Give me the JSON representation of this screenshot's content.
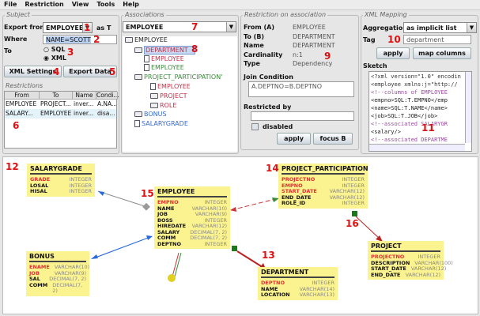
{
  "menu": [
    "File",
    "Restriction",
    "View",
    "Tools",
    "Help"
  ],
  "subject": {
    "title": "Subject",
    "export_from_label": "Export from",
    "export_from_value": "EMPLOYEE",
    "as_label": "as T",
    "where_label": "Where",
    "where_value": "NAME=SCOTT",
    "to_label": "To",
    "sql": "SQL",
    "xml": "XML",
    "selected": "XML",
    "xml_settings": "XML Settings",
    "export_data": "Export Data"
  },
  "restrictions": {
    "title": "Restrictions",
    "columns": [
      "From",
      "To",
      "Name",
      "Condi..."
    ],
    "rows": [
      [
        "EMPLOYEE",
        "PROJECT...",
        "inver...",
        "A.NA..."
      ],
      [
        "SALARY...",
        "EMPLOYEE",
        "inver...",
        "disa..."
      ]
    ]
  },
  "associations": {
    "title": "Associations",
    "combo": "EMPLOYEE",
    "tree": [
      {
        "label": "EMPLOYEE",
        "color": "#222",
        "icon": "folder"
      },
      {
        "label": "DEPARTMENT",
        "color": "#c0304a",
        "icon": "folder",
        "selected": true
      },
      {
        "label": "EMPLOYEE",
        "color": "#c0304a",
        "icon": "doc"
      },
      {
        "label": "EMPLOYEE",
        "color": "#3a8a3a",
        "icon": "doc"
      },
      {
        "label": "PROJECT_PARTICIPATION'",
        "color": "#3a8a3a",
        "icon": "folder"
      },
      {
        "label": "EMPLOYEE",
        "color": "#c0304a",
        "icon": "doc"
      },
      {
        "label": "PROJECT",
        "color": "#c0304a",
        "icon": "folder"
      },
      {
        "label": "ROLE",
        "color": "#c0304a",
        "icon": "folder"
      },
      {
        "label": "BONUS",
        "color": "#3a6ad0",
        "icon": "folder"
      },
      {
        "label": "SALARYGRADE",
        "color": "#3a6ad0",
        "icon": "doc"
      }
    ]
  },
  "restriction": {
    "title": "Restriction on association",
    "fields": [
      [
        "From (A)",
        "EMPLOYEE"
      ],
      [
        "To (B)",
        "DEPARTMENT"
      ],
      [
        "Name",
        "DEPARTMENT"
      ],
      [
        "Cardinality",
        "n:1"
      ],
      [
        "Type",
        "Dependency"
      ]
    ],
    "join_label": "Join Condition",
    "join_value": "A.DEPTNO=B.DEPTNO",
    "restricted_by_label": "Restricted by",
    "restricted_by_value": "",
    "disabled_label": "disabled",
    "apply": "apply",
    "focus": "focus B"
  },
  "xml_mapping": {
    "title": "XML Mapping",
    "aggregation_label": "Aggregation",
    "aggregation_value": "as implicit list",
    "tag_label": "Tag",
    "tag_value": "department",
    "apply": "apply",
    "map_columns": "map columns",
    "sketch_label": "Sketch",
    "sketch": [
      {
        "text": "<?xml version=\"1.0\" encodin",
        "color": "#333"
      },
      {
        "text": "<employee xmlns:j=\"http://",
        "color": "#333"
      },
      {
        "text": "   <!--columns of EMPLOYEE",
        "color": "#9a4aa0"
      },
      {
        "text": "   <empno>SQL:T.EMPNO</emp",
        "color": "#222"
      },
      {
        "text": "   <name>SQL:T.NAME</name>",
        "color": "#222"
      },
      {
        "text": "   <job>SQL:T.JOB</job>",
        "color": "#222"
      },
      {
        "text": "   <!--associated SALARYGR",
        "color": "#9a4aa0"
      },
      {
        "text": "   <salary/>",
        "color": "#222"
      },
      {
        "text": "   <!--associated DEPARTME",
        "color": "#9a4aa0"
      }
    ]
  },
  "callouts": [
    "1",
    "2",
    "3",
    "4",
    "5",
    "6",
    "7",
    "8",
    "9",
    "10",
    "11",
    "12",
    "13",
    "14",
    "15",
    "16"
  ],
  "entities": {
    "salarygrade": {
      "name": "SALARYGRADE",
      "cols": [
        [
          "GRADE",
          "INTEGER",
          true
        ],
        [
          "LOSAL",
          "INTEGER",
          false
        ],
        [
          "HISAL",
          "INTEGER",
          false
        ]
      ]
    },
    "employee": {
      "name": "EMPLOYEE",
      "cols": [
        [
          "EMPNO",
          "INTEGER",
          true
        ],
        [
          "NAME",
          "VARCHAR(10)",
          false
        ],
        [
          "JOB",
          "VARCHAR(9)",
          false
        ],
        [
          "BOSS",
          "INTEGER",
          false
        ],
        [
          "HIREDATE",
          "VARCHAR(12)",
          false
        ],
        [
          "SALARY",
          "DECIMAL(7, 2)",
          false
        ],
        [
          "COMM",
          "DECIMAL(7, 2)",
          false
        ],
        [
          "DEPTNO",
          "INTEGER",
          false
        ]
      ]
    },
    "bonus": {
      "name": "BONUS",
      "cols": [
        [
          "ENAME",
          "VARCHAR(10)",
          true
        ],
        [
          "JOB",
          "VARCHAR(9)",
          true
        ],
        [
          "SAL",
          "DECIMAL(7, 2)",
          false
        ],
        [
          "COMM",
          "DECIMAL(7, 2)",
          false
        ]
      ]
    },
    "project_participation": {
      "name": "PROJECT_PARTICIPATION",
      "cols": [
        [
          "PROJECTNO",
          "INTEGER",
          true
        ],
        [
          "EMPNO",
          "INTEGER",
          true
        ],
        [
          "START_DATE",
          "VARCHAR(12)",
          true
        ],
        [
          "END_DATE",
          "VARCHAR(12)",
          false
        ],
        [
          "ROLE_ID",
          "INTEGER",
          false
        ]
      ]
    },
    "department": {
      "name": "DEPARTMENT",
      "cols": [
        [
          "DEPTNO",
          "INTEGER",
          true
        ],
        [
          "NAME",
          "VARCHAR(14)",
          false
        ],
        [
          "LOCATION",
          "VARCHAR(13)",
          false
        ]
      ]
    },
    "project": {
      "name": "PROJECT",
      "cols": [
        [
          "PROJECTNO",
          "INTEGER",
          true
        ],
        [
          "DESCRIPTION",
          "VARCHAR(100)",
          false
        ],
        [
          "START_DATE",
          "VARCHAR(12)",
          false
        ],
        [
          "END_DATE",
          "VARCHAR(12)",
          false
        ]
      ]
    }
  }
}
